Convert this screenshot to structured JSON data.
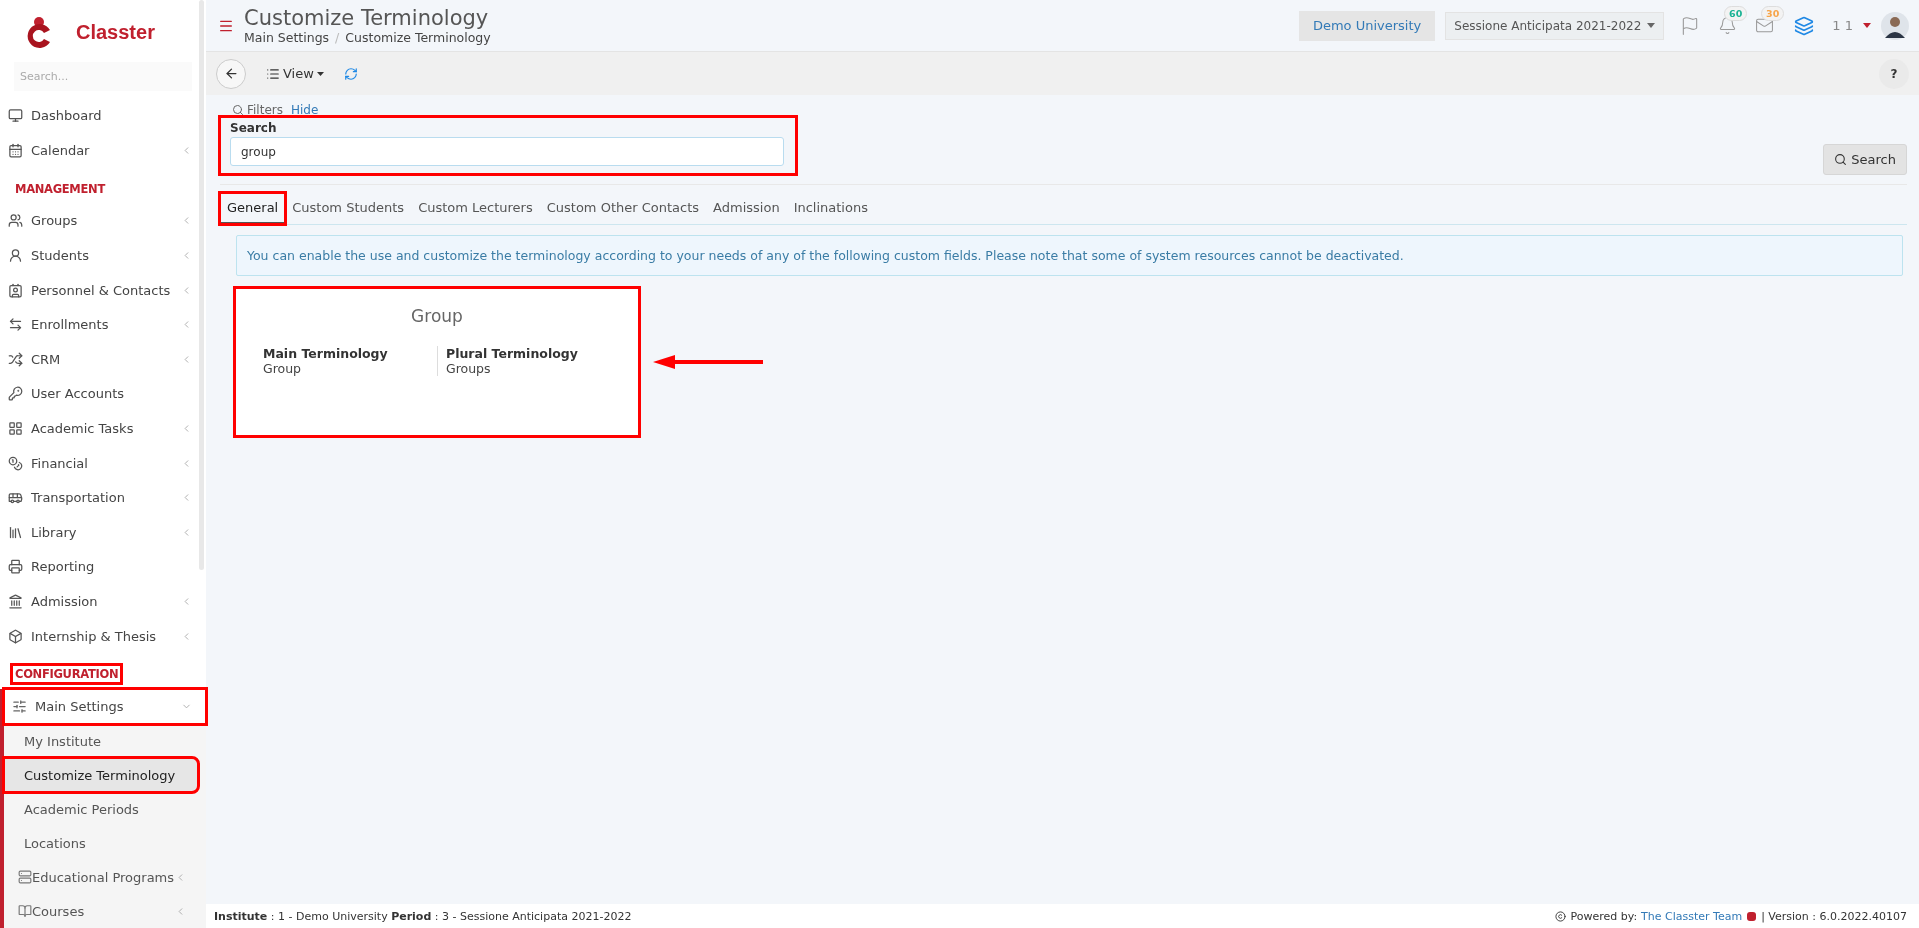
{
  "brand": {
    "name": "Classter"
  },
  "sidebar": {
    "search": {
      "placeholder": "Search..."
    },
    "sections": [
      {
        "items": [
          {
            "label": "Dashboard",
            "expandable": false
          },
          {
            "label": "Calendar",
            "expandable": true
          }
        ]
      },
      {
        "heading": "MANAGEMENT",
        "highlighted": false,
        "items": [
          {
            "label": "Groups",
            "expandable": true
          },
          {
            "label": "Students",
            "expandable": true
          },
          {
            "label": "Personnel & Contacts",
            "expandable": true
          },
          {
            "label": "Enrollments",
            "expandable": true
          },
          {
            "label": "CRM",
            "expandable": true
          },
          {
            "label": "User Accounts",
            "expandable": false
          },
          {
            "label": "Academic Tasks",
            "expandable": true
          },
          {
            "label": "Financial",
            "expandable": true
          },
          {
            "label": "Transportation",
            "expandable": true
          },
          {
            "label": "Library",
            "expandable": true
          },
          {
            "label": "Reporting",
            "expandable": false
          },
          {
            "label": "Admission",
            "expandable": true
          },
          {
            "label": "Internship & Thesis",
            "expandable": true
          }
        ]
      },
      {
        "heading": "CONFIGURATION",
        "highlighted": true,
        "items": [
          {
            "label": "Main Settings",
            "expandable": true,
            "expanded": true,
            "highlighted": true,
            "children": [
              {
                "label": "My Institute",
                "selected": false,
                "highlighted": false,
                "expandable": false
              },
              {
                "label": "Customize Terminology",
                "selected": true,
                "highlighted": true,
                "expandable": false
              },
              {
                "label": "Academic Periods",
                "selected": false,
                "highlighted": false,
                "expandable": false
              },
              {
                "label": "Locations",
                "selected": false,
                "highlighted": false,
                "expandable": false
              },
              {
                "label": "Educational Programs",
                "selected": false,
                "highlighted": false,
                "expandable": true,
                "kind": "icon"
              },
              {
                "label": "Courses",
                "selected": false,
                "highlighted": false,
                "expandable": true,
                "kind": "icon"
              }
            ]
          }
        ]
      }
    ]
  },
  "header": {
    "title": "Customize Terminology",
    "breadcrumb": [
      "Main Settings",
      "Customize Terminology"
    ],
    "breadcrumb_separator": "/",
    "institute": "Demo University",
    "period": "Sessione Anticipata 2021-2022",
    "badges": [
      {
        "kind": "bell",
        "count": "60",
        "color": "#1ab394"
      },
      {
        "kind": "mail",
        "count": "30",
        "color": "#f7a54a"
      }
    ],
    "user": "1 1"
  },
  "toolbar": {
    "view": "View",
    "help": "?"
  },
  "filters": {
    "label": "Filters",
    "hide": "Hide",
    "search_label": "Search",
    "search_value": "group",
    "highlighted": true,
    "button": "Search"
  },
  "tabs": [
    {
      "label": "General",
      "selected": true,
      "highlighted": true
    },
    {
      "label": "Custom Students",
      "selected": false,
      "highlighted": false
    },
    {
      "label": "Custom Lecturers",
      "selected": false,
      "highlighted": false
    },
    {
      "label": "Custom Other Contacts",
      "selected": false,
      "highlighted": false
    },
    {
      "label": "Admission",
      "selected": false,
      "highlighted": false
    },
    {
      "label": "Inclinations",
      "selected": false,
      "highlighted": false
    }
  ],
  "info": "You can enable the use and customize the terminology according to your needs of any of the following custom fields. Please note that some of system resources cannot be deactivated.",
  "cards": [
    {
      "title": "Group",
      "highlighted": true,
      "arrow": true,
      "fields": [
        {
          "label": "Main Terminology",
          "value": "Group"
        },
        {
          "label": "Plural Terminology",
          "value": "Groups"
        }
      ]
    }
  ],
  "footer": {
    "status": "**Institute** : 1 - Demo University **Period** : 3 - Sessione Anticipata 2021-2022",
    "powered": "Powered by:",
    "team": "The Classter Team",
    "version": "| Version : 6.0.2022.40107"
  }
}
